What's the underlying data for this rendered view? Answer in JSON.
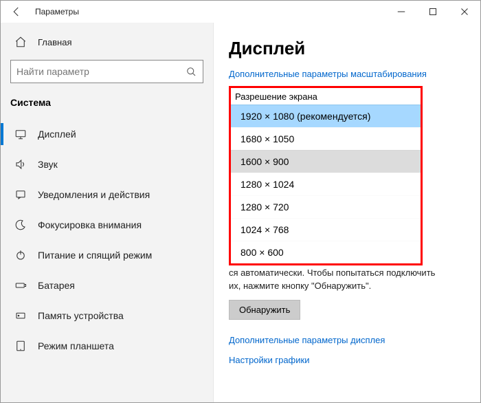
{
  "titlebar": {
    "title": "Параметры"
  },
  "sidebar": {
    "home": "Главная",
    "search_placeholder": "Найти параметр",
    "section": "Система",
    "items": [
      {
        "label": "Дисплей"
      },
      {
        "label": "Звук"
      },
      {
        "label": "Уведомления и действия"
      },
      {
        "label": "Фокусировка внимания"
      },
      {
        "label": "Питание и спящий режим"
      },
      {
        "label": "Батарея"
      },
      {
        "label": "Память устройства"
      },
      {
        "label": "Режим планшета"
      }
    ]
  },
  "main": {
    "title": "Дисплей",
    "scaling_link": "Дополнительные параметры масштабирования",
    "resolution_label": "Разрешение экрана",
    "resolutions": [
      "1920 × 1080 (рекомендуется)",
      "1680 × 1050",
      "1600 × 900",
      "1280 × 1024",
      "1280 × 720",
      "1024 × 768",
      "800 × 600"
    ],
    "detect_text_trail": "ся автоматически. Чтобы попытаться подключить их, нажмите кнопку \"Обнаружить\".",
    "detect_button": "Обнаружить",
    "adv_display_link": "Дополнительные параметры дисплея",
    "graphics_link": "Настройки графики"
  }
}
